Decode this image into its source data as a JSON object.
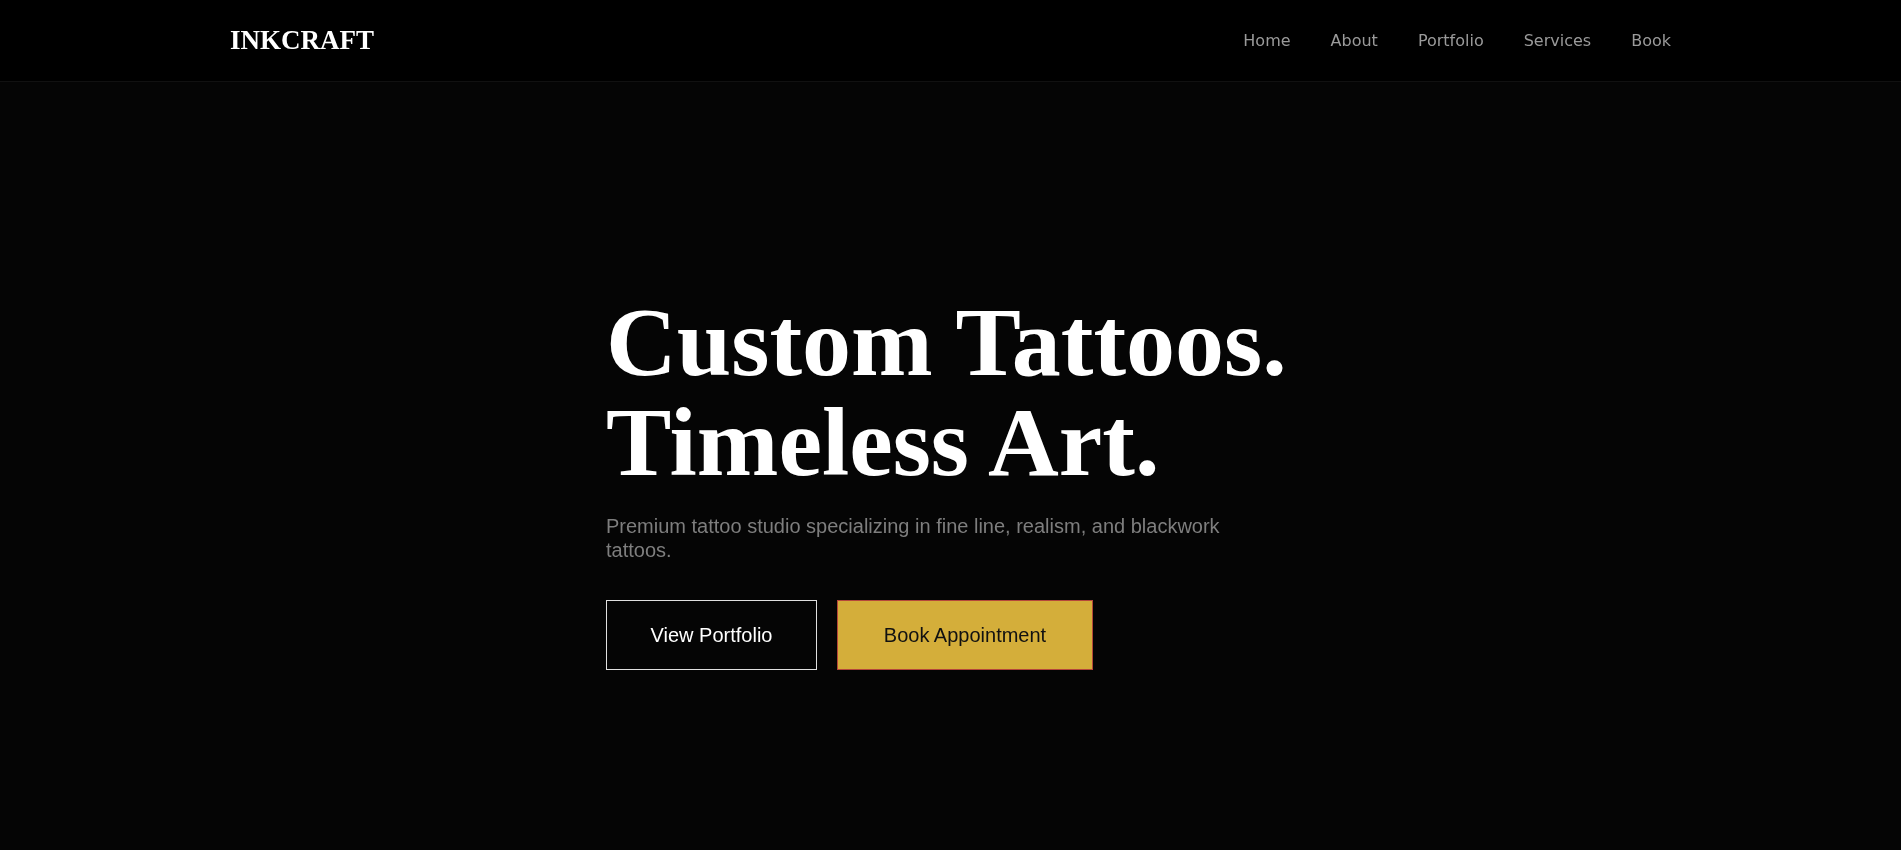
{
  "logo": "INKCRAFT",
  "nav": [
    {
      "label": "Home"
    },
    {
      "label": "About"
    },
    {
      "label": "Portfolio"
    },
    {
      "label": "Services"
    },
    {
      "label": "Book"
    }
  ],
  "hero": {
    "headline_lines": [
      "Custom Tattoos.",
      "Timeless Art."
    ],
    "subtitle": "Premium tattoo studio specializing in fine line, realism, and blackwork tattoos.",
    "buttons": [
      {
        "label": "View Portfolio",
        "kind": "outline"
      },
      {
        "label": "Book Appointment",
        "kind": "filled"
      }
    ]
  }
}
